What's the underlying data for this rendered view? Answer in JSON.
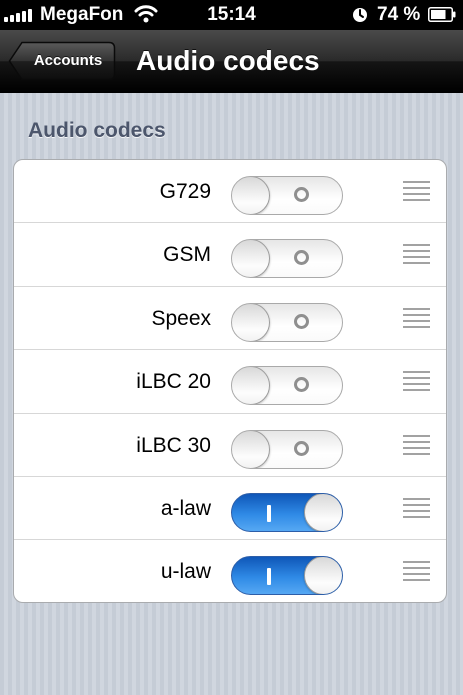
{
  "status_bar": {
    "carrier": "MegaFon",
    "time": "15:14",
    "battery_percent": "74 %"
  },
  "nav": {
    "back_label": "Accounts",
    "title": "Audio codecs"
  },
  "section": {
    "header": "Audio codecs"
  },
  "codecs": [
    {
      "name": "G729",
      "enabled": false
    },
    {
      "name": "GSM",
      "enabled": false
    },
    {
      "name": "Speex",
      "enabled": false
    },
    {
      "name": "iLBC 20",
      "enabled": false
    },
    {
      "name": "iLBC 30",
      "enabled": false
    },
    {
      "name": "a-law",
      "enabled": true
    },
    {
      "name": "u-law",
      "enabled": true
    }
  ],
  "colors": {
    "switch_on": "#2f8ae6",
    "nav_bar": "#1a1a1a",
    "section_header": "#4c566c"
  },
  "icons": {
    "signal": "signal-bars-icon",
    "wifi": "wifi-icon",
    "clock": "alarm-clock-icon",
    "battery": "battery-icon",
    "grip": "reorder-grip-icon"
  }
}
